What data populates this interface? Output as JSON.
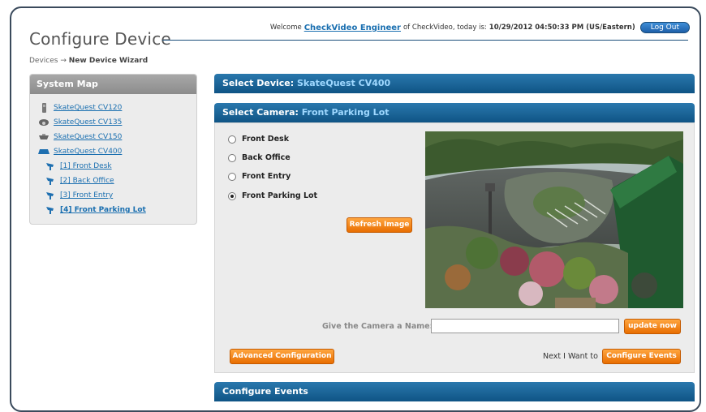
{
  "header": {
    "title": "Configure Device",
    "welcome_prefix": "Welcome",
    "user_name": "CheckVideo Engineer",
    "welcome_mid": "of CheckVideo, today is:",
    "datetime": "10/29/2012 04:50:33 PM (US/Eastern)",
    "logout_label": "Log Out"
  },
  "breadcrumb": {
    "root": "Devices",
    "sep": "→",
    "current": "New Device Wizard"
  },
  "sidebar": {
    "title": "System Map",
    "items": [
      {
        "label": "SkateQuest CV120",
        "icon": "camera-tower-icon"
      },
      {
        "label": "SkateQuest CV135",
        "icon": "dome-camera-icon"
      },
      {
        "label": "SkateQuest CV150",
        "icon": "dome-camera-icon"
      },
      {
        "label": "SkateQuest CV400",
        "icon": "dvr-device-icon"
      },
      {
        "label": "[1] Front Desk",
        "icon": "camera-icon"
      },
      {
        "label": "[2] Back Office",
        "icon": "camera-icon"
      },
      {
        "label": "[3] Front Entry",
        "icon": "camera-icon"
      },
      {
        "label": "[4] Front Parking Lot",
        "icon": "camera-icon"
      }
    ]
  },
  "select_device": {
    "label": "Select Device:",
    "value": "SkateQuest CV400"
  },
  "select_camera": {
    "label": "Select Camera:",
    "value": "Front Parking Lot",
    "options": [
      "Front Desk",
      "Back Office",
      "Front Entry",
      "Front Parking Lot"
    ],
    "selected": "Front Parking Lot",
    "refresh_label": "Refresh Image",
    "name_label": "Give the Camera a Name:",
    "name_value": "",
    "update_label": "update now",
    "advanced_label": "Advanced Configuration",
    "next_label": "Next I Want to",
    "configure_events_label": "Configure Events"
  },
  "configure_events": {
    "label": "Configure Events"
  },
  "colors": {
    "accent_blue": "#0f5485",
    "button_orange": "#f28a1a",
    "link_blue": "#1a6fb0"
  }
}
